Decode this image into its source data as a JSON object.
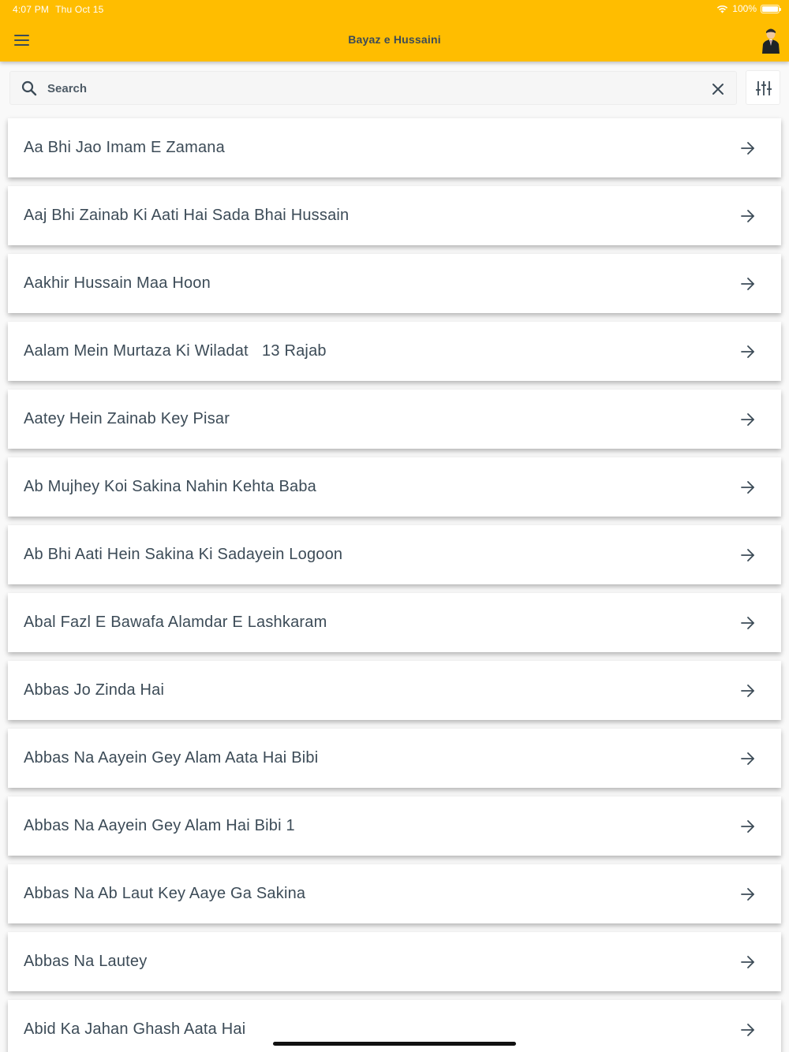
{
  "status_bar": {
    "time": "4:07 PM",
    "date": "Thu Oct 15",
    "battery": "100%"
  },
  "header": {
    "title": "Bayaz e Hussaini"
  },
  "search": {
    "placeholder": "Search",
    "value": ""
  },
  "list": {
    "items": [
      {
        "label": "Aa Bhi Jao Imam E Zamana"
      },
      {
        "label": "Aaj Bhi Zainab Ki Aati Hai Sada Bhai Hussain"
      },
      {
        "label": "Aakhir Hussain Maa Hoon"
      },
      {
        "label": "Aalam Mein Murtaza Ki Wiladat   13 Rajab"
      },
      {
        "label": "Aatey Hein Zainab Key Pisar"
      },
      {
        "label": "Ab Mujhey Koi Sakina Nahin Kehta Baba"
      },
      {
        "label": "Ab Bhi Aati Hein Sakina Ki Sadayein Logoon"
      },
      {
        "label": "Abal Fazl E Bawafa Alamdar E Lashkaram"
      },
      {
        "label": "Abbas Jo Zinda Hai"
      },
      {
        "label": "Abbas Na Aayein Gey Alam Aata Hai Bibi"
      },
      {
        "label": "Abbas Na Aayein Gey Alam Hai Bibi 1"
      },
      {
        "label": "Abbas Na Ab Laut Key Aaye Ga Sakina"
      },
      {
        "label": "Abbas Na Lautey"
      },
      {
        "label": "Abid Ka Jahan Ghash Aata Hai"
      }
    ]
  },
  "colors": {
    "header_bg": "#ffbd00",
    "text": "#3c4b57",
    "card_bg": "#ffffff"
  },
  "icons": {
    "menu": "hamburger-menu-icon",
    "avatar": "user-avatar-icon",
    "search": "search-icon",
    "clear": "close-icon",
    "filter": "sliders-icon",
    "item_arrow": "arrow-right-icon"
  }
}
